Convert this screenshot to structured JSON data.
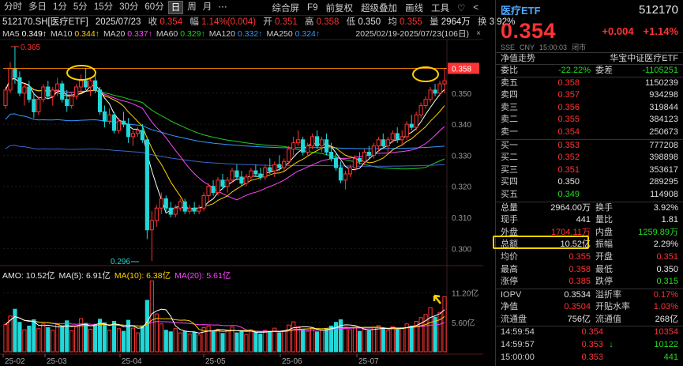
{
  "toolbar": {
    "periods": [
      "分时",
      "多日",
      "1分",
      "5分",
      "15分",
      "30分",
      "60分",
      "日",
      "周",
      "月",
      "⋯"
    ],
    "active_period": "日",
    "right_items": [
      "综合屏",
      "F9",
      "前复权",
      "超级叠加",
      "画线",
      "工具",
      "♡",
      "<"
    ]
  },
  "header": {
    "symbol": "512170.SH[医疗ETF]",
    "date": "2025/07/23",
    "close_label": "收",
    "close": "0.354",
    "chg_label": "幅",
    "chg": "1.14%(0.004)",
    "open_label": "开",
    "open": "0.351",
    "high_label": "高",
    "high": "0.358",
    "low_label": "低",
    "low": "0.350",
    "prev_label": "均",
    "prev": "0.355",
    "vol_label": "量",
    "vol": "2964万",
    "turn_label": "换",
    "turn": "3.92%"
  },
  "ma": [
    {
      "name": "MA5",
      "value": "0.349↑",
      "color": "#ffffff"
    },
    {
      "name": "MA10",
      "value": "0.344↑",
      "color": "#ffd200"
    },
    {
      "name": "MA20",
      "value": "0.337↑",
      "color": "#ff44ff"
    },
    {
      "name": "MA60",
      "value": "0.329↑",
      "color": "#22cc22"
    },
    {
      "name": "MA120",
      "value": "0.332↑",
      "color": "#3399ff"
    },
    {
      "name": "MA250",
      "value": "0.324↑",
      "color": "#3399ff"
    }
  ],
  "range": "2025/02/19-2025/07/23(106日)",
  "range_close": "×",
  "price_axis": [
    "0.350",
    "0.340",
    "0.330",
    "0.320",
    "0.310",
    "0.300"
  ],
  "price_marker": "0.358",
  "high_annotation": "0.365",
  "low_annotation": "0.296",
  "vol_axis": [
    "11.20亿",
    "5.60亿"
  ],
  "x_axis": [
    "25-02",
    "25-03",
    "25-04",
    "25-05",
    "25-06",
    "25-07"
  ],
  "vol_header": [
    {
      "text": "AMO: 10.52亿",
      "color": "#e6e6e6"
    },
    {
      "text": "MA(5): 6.91亿",
      "color": "#e6e6e6"
    },
    {
      "text": "MA(10): 6.38亿",
      "color": "#ffd200"
    },
    {
      "text": "MA(20): 5.61亿",
      "color": "#ff44ff"
    }
  ],
  "chart_data": {
    "type": "candlestick",
    "ylim": [
      0.296,
      0.366
    ],
    "dates_label": "2025/02/19-2025/07/23",
    "candles": [
      [
        0.346,
        0.352,
        0.345,
        0.351
      ],
      [
        0.351,
        0.36,
        0.35,
        0.358
      ],
      [
        0.358,
        0.365,
        0.353,
        0.355
      ],
      [
        0.355,
        0.357,
        0.349,
        0.35
      ],
      [
        0.35,
        0.353,
        0.346,
        0.352
      ],
      [
        0.352,
        0.354,
        0.347,
        0.348
      ],
      [
        0.348,
        0.35,
        0.342,
        0.344
      ],
      [
        0.344,
        0.349,
        0.343,
        0.348
      ],
      [
        0.348,
        0.353,
        0.347,
        0.352
      ],
      [
        0.352,
        0.354,
        0.348,
        0.349
      ],
      [
        0.349,
        0.352,
        0.346,
        0.351
      ],
      [
        0.351,
        0.355,
        0.349,
        0.353
      ],
      [
        0.353,
        0.354,
        0.347,
        0.348
      ],
      [
        0.348,
        0.351,
        0.344,
        0.346
      ],
      [
        0.346,
        0.35,
        0.345,
        0.349
      ],
      [
        0.349,
        0.353,
        0.348,
        0.352
      ],
      [
        0.352,
        0.356,
        0.35,
        0.354
      ],
      [
        0.354,
        0.358,
        0.351,
        0.352
      ],
      [
        0.352,
        0.355,
        0.349,
        0.354
      ],
      [
        0.354,
        0.357,
        0.35,
        0.351
      ],
      [
        0.351,
        0.352,
        0.343,
        0.344
      ],
      [
        0.344,
        0.346,
        0.339,
        0.341
      ],
      [
        0.341,
        0.345,
        0.34,
        0.343
      ],
      [
        0.343,
        0.344,
        0.337,
        0.338
      ],
      [
        0.338,
        0.342,
        0.337,
        0.341
      ],
      [
        0.341,
        0.344,
        0.339,
        0.34
      ],
      [
        0.34,
        0.342,
        0.334,
        0.336
      ],
      [
        0.336,
        0.338,
        0.333,
        0.337
      ],
      [
        0.337,
        0.339,
        0.336,
        0.338
      ],
      [
        0.338,
        0.34,
        0.334,
        0.335
      ],
      [
        0.335,
        0.336,
        0.303,
        0.306
      ],
      [
        0.306,
        0.312,
        0.296,
        0.309
      ],
      [
        0.309,
        0.314,
        0.307,
        0.313
      ],
      [
        0.313,
        0.318,
        0.311,
        0.316
      ],
      [
        0.316,
        0.317,
        0.312,
        0.313
      ],
      [
        0.313,
        0.315,
        0.31,
        0.311
      ],
      [
        0.311,
        0.314,
        0.31,
        0.313
      ],
      [
        0.313,
        0.316,
        0.312,
        0.315
      ],
      [
        0.315,
        0.316,
        0.311,
        0.312
      ],
      [
        0.312,
        0.314,
        0.311,
        0.313
      ],
      [
        0.313,
        0.315,
        0.311,
        0.312
      ],
      [
        0.312,
        0.314,
        0.311,
        0.313
      ],
      [
        0.313,
        0.318,
        0.312,
        0.317
      ],
      [
        0.317,
        0.321,
        0.315,
        0.32
      ],
      [
        0.32,
        0.322,
        0.317,
        0.318
      ],
      [
        0.318,
        0.323,
        0.317,
        0.322
      ],
      [
        0.322,
        0.324,
        0.319,
        0.32
      ],
      [
        0.32,
        0.323,
        0.318,
        0.322
      ],
      [
        0.322,
        0.326,
        0.321,
        0.325
      ],
      [
        0.325,
        0.327,
        0.322,
        0.323
      ],
      [
        0.323,
        0.325,
        0.32,
        0.321
      ],
      [
        0.321,
        0.324,
        0.32,
        0.323
      ],
      [
        0.323,
        0.326,
        0.322,
        0.325
      ],
      [
        0.325,
        0.327,
        0.323,
        0.324
      ],
      [
        0.324,
        0.326,
        0.322,
        0.323
      ],
      [
        0.323,
        0.327,
        0.322,
        0.326
      ],
      [
        0.326,
        0.329,
        0.324,
        0.325
      ],
      [
        0.325,
        0.328,
        0.323,
        0.327
      ],
      [
        0.327,
        0.33,
        0.325,
        0.326
      ],
      [
        0.326,
        0.329,
        0.325,
        0.328
      ],
      [
        0.328,
        0.333,
        0.327,
        0.332
      ],
      [
        0.332,
        0.336,
        0.33,
        0.334
      ],
      [
        0.334,
        0.338,
        0.333,
        0.335
      ],
      [
        0.335,
        0.336,
        0.33,
        0.331
      ],
      [
        0.331,
        0.334,
        0.33,
        0.333
      ],
      [
        0.333,
        0.337,
        0.332,
        0.336
      ],
      [
        0.336,
        0.338,
        0.332,
        0.333
      ],
      [
        0.333,
        0.336,
        0.331,
        0.335
      ],
      [
        0.335,
        0.337,
        0.33,
        0.331
      ],
      [
        0.331,
        0.334,
        0.328,
        0.329
      ],
      [
        0.329,
        0.331,
        0.325,
        0.326
      ],
      [
        0.326,
        0.328,
        0.321,
        0.322
      ],
      [
        0.322,
        0.325,
        0.319,
        0.324
      ],
      [
        0.324,
        0.327,
        0.323,
        0.326
      ],
      [
        0.326,
        0.33,
        0.325,
        0.329
      ],
      [
        0.329,
        0.331,
        0.327,
        0.328
      ],
      [
        0.328,
        0.332,
        0.327,
        0.331
      ],
      [
        0.331,
        0.333,
        0.329,
        0.33
      ],
      [
        0.33,
        0.334,
        0.329,
        0.333
      ],
      [
        0.333,
        0.336,
        0.331,
        0.335
      ],
      [
        0.335,
        0.337,
        0.332,
        0.333
      ],
      [
        0.333,
        0.336,
        0.331,
        0.335
      ],
      [
        0.335,
        0.338,
        0.334,
        0.337
      ],
      [
        0.337,
        0.339,
        0.334,
        0.335
      ],
      [
        0.335,
        0.338,
        0.333,
        0.336
      ],
      [
        0.336,
        0.341,
        0.335,
        0.34
      ],
      [
        0.34,
        0.343,
        0.338,
        0.339
      ],
      [
        0.339,
        0.344,
        0.338,
        0.343
      ],
      [
        0.343,
        0.347,
        0.342,
        0.346
      ],
      [
        0.346,
        0.349,
        0.345,
        0.348
      ],
      [
        0.348,
        0.352,
        0.347,
        0.351
      ],
      [
        0.351,
        0.353,
        0.349,
        0.35
      ],
      [
        0.35,
        0.354,
        0.349,
        0.353
      ],
      [
        0.353,
        0.358,
        0.35,
        0.354
      ]
    ],
    "volume": [
      5.2,
      6.8,
      8.1,
      5.6,
      4.2,
      4.9,
      6.1,
      4.4,
      5.3,
      4.6,
      4.1,
      5.2,
      4.8,
      5.9,
      4.0,
      4.7,
      6.3,
      5.4,
      4.3,
      5.0,
      6.2,
      5.5,
      4.1,
      5.8,
      4.4,
      3.9,
      6.0,
      4.5,
      3.6,
      4.8,
      9.8,
      13.5,
      7.2,
      5.3,
      4.1,
      3.8,
      4.4,
      3.6,
      3.9,
      3.4,
      3.7,
      3.2,
      4.6,
      4.9,
      3.8,
      4.3,
      3.5,
      4.0,
      4.7,
      3.6,
      3.9,
      3.3,
      4.2,
      3.7,
      3.4,
      4.1,
      3.8,
      4.5,
      3.6,
      4.0,
      5.1,
      5.7,
      4.8,
      4.2,
      3.9,
      4.6,
      3.8,
      4.1,
      4.4,
      4.9,
      5.6,
      6.1,
      4.7,
      4.2,
      4.5,
      3.9,
      4.3,
      4.0,
      4.6,
      5.0,
      4.4,
      4.1,
      4.8,
      4.3,
      4.6,
      5.3,
      4.9,
      5.8,
      6.5,
      7.1,
      8.4,
      6.6,
      7.5,
      10.5
    ],
    "volume_ylim": [
      0,
      14
    ],
    "volume_unit": "亿"
  },
  "quote": {
    "name": "医疗ETF",
    "code": "512170",
    "price": "0.354",
    "change": "+0.004",
    "change_pct": "+1.14%",
    "meta": [
      "SSE",
      "CNY",
      "15:00:03",
      "闭市"
    ],
    "sub_left": "净值走势",
    "sub_right": "华宝中证医疗ETF",
    "weibi_label": "委比",
    "weibi": "-22.22%",
    "weicha_label": "委差",
    "weicha": "-1105251",
    "asks": [
      {
        "label": "卖五",
        "price": "0.358",
        "vol": "1150239"
      },
      {
        "label": "卖四",
        "price": "0.357",
        "vol": "934298"
      },
      {
        "label": "卖三",
        "price": "0.356",
        "vol": "319844"
      },
      {
        "label": "卖二",
        "price": "0.355",
        "vol": "384123"
      },
      {
        "label": "卖一",
        "price": "0.354",
        "vol": "250673"
      }
    ],
    "bids": [
      {
        "label": "买一",
        "price": "0.353",
        "vol": "777208"
      },
      {
        "label": "买二",
        "price": "0.352",
        "vol": "398898"
      },
      {
        "label": "买三",
        "price": "0.351",
        "vol": "353617"
      },
      {
        "label": "买四",
        "price": "0.350",
        "vol": "289295"
      },
      {
        "label": "买五",
        "price": "0.349",
        "vol": "114908"
      }
    ],
    "stats": [
      {
        "l1": "总量",
        "v1": "2964.00万",
        "c1": "white",
        "l2": "换手",
        "v2": "3.92%",
        "c2": "white"
      },
      {
        "l1": "现手",
        "v1": "441",
        "c1": "white",
        "l2": "量比",
        "v2": "1.81",
        "c2": "white"
      },
      {
        "l1": "外盘",
        "v1": "1704.11万",
        "c1": "up",
        "l2": "内盘",
        "v2": "1259.89万",
        "c2": "down"
      },
      {
        "l1": "总额",
        "v1": "10.52亿",
        "c1": "white",
        "l2": "振幅",
        "v2": "2.29%",
        "c2": "white"
      },
      {
        "l1": "均价",
        "v1": "0.355",
        "c1": "up",
        "l2": "开盘",
        "v2": "0.351",
        "c2": "up"
      },
      {
        "l1": "最高",
        "v1": "0.358",
        "c1": "up",
        "l2": "最低",
        "v2": "0.350",
        "c2": "white"
      },
      {
        "l1": "涨停",
        "v1": "0.385",
        "c1": "up",
        "l2": "跌停",
        "v2": "0.315",
        "c2": "down"
      }
    ],
    "stats2": [
      {
        "l1": "IOPV",
        "v1": "0.3534",
        "c1": "white",
        "l2": "溢折率",
        "v2": "0.17%",
        "c2": "up"
      },
      {
        "l1": "净值",
        "v1": "0.3504",
        "c1": "up",
        "l2": "开贴水率",
        "v2": "1.03%",
        "c2": "up"
      },
      {
        "l1": "流通盘",
        "v1": "756亿",
        "c1": "white",
        "l2": "流通值",
        "v2": "268亿",
        "c2": "white"
      }
    ],
    "ticks": [
      {
        "time": "14:59:54",
        "price": "0.354",
        "arrow": "",
        "vol": "10354",
        "pc": "up",
        "vc": "up"
      },
      {
        "time": "14:59:57",
        "price": "0.353",
        "arrow": "↓",
        "vol": "10122",
        "pc": "up",
        "vc": "down"
      },
      {
        "time": "15:00:00",
        "price": "0.353",
        "arrow": "",
        "vol": "441",
        "pc": "up",
        "vc": "down"
      }
    ]
  }
}
